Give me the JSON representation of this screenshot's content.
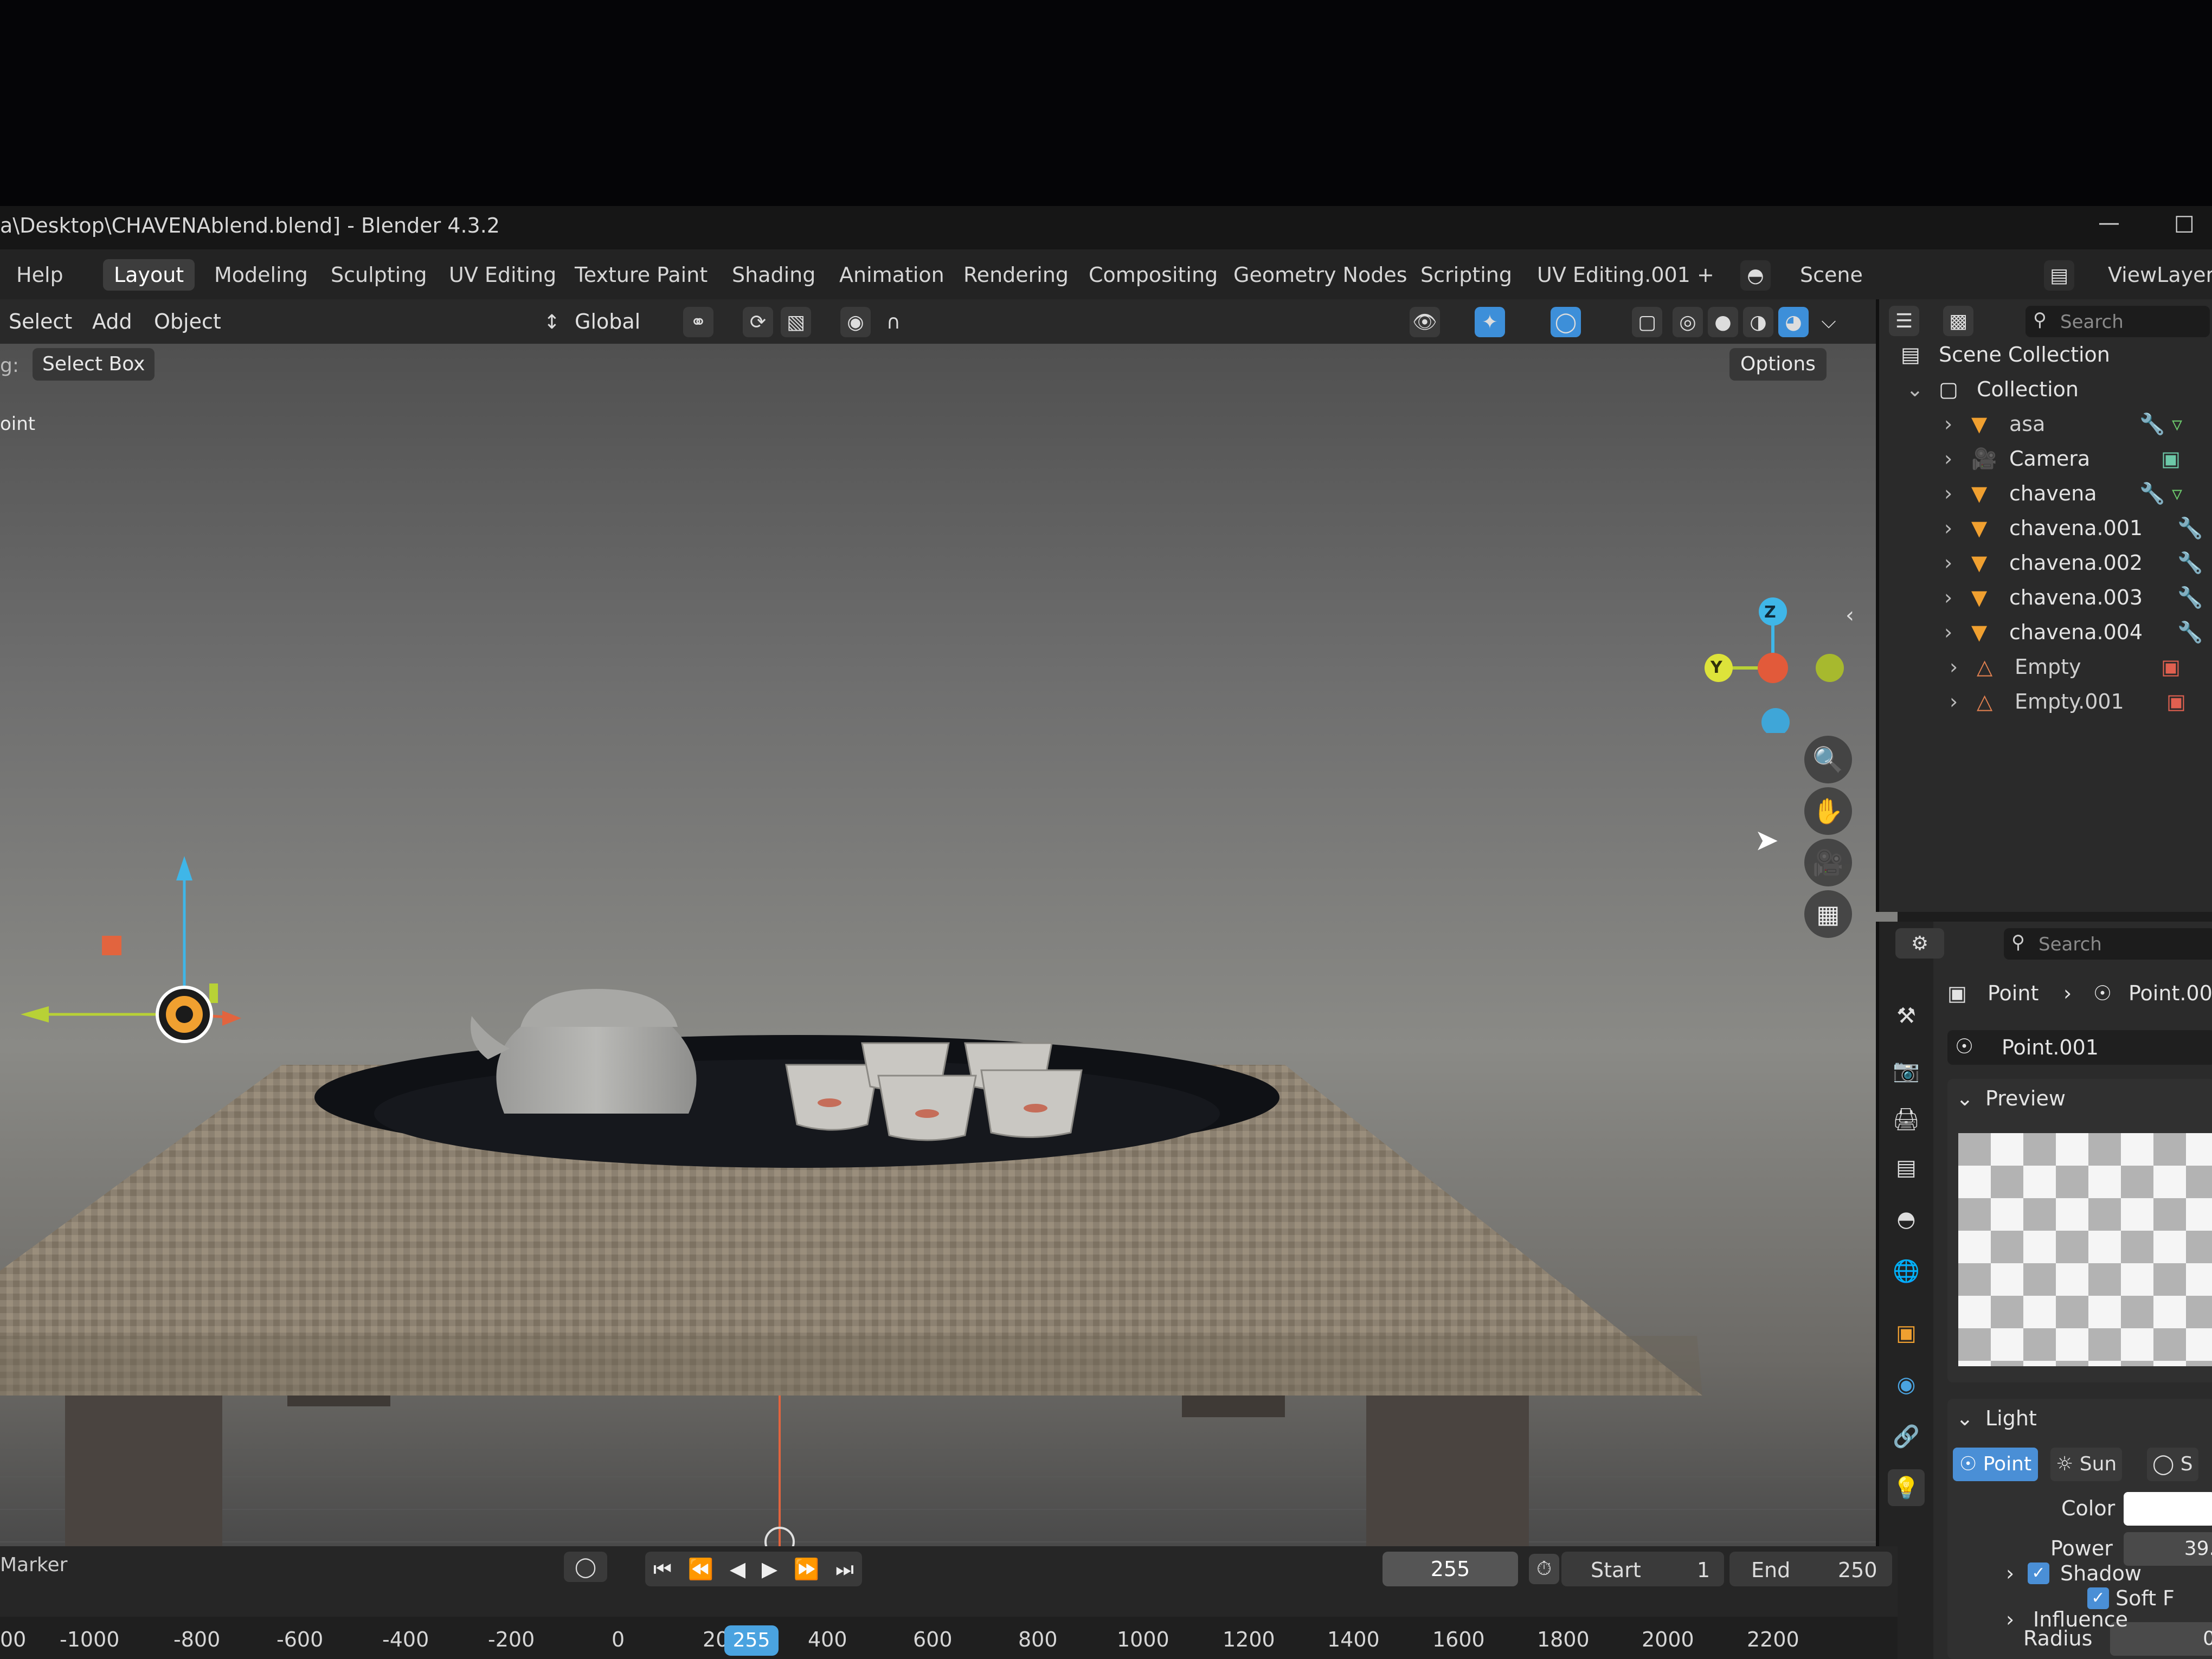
{
  "window": {
    "title": "a\\Desktop\\CHAVENAblend.blend] - Blender 4.3.2",
    "minimize": "—",
    "maximize": "□"
  },
  "menubar": {
    "help": "Help",
    "tabs": [
      "Layout",
      "Modeling",
      "Sculpting",
      "UV Editing",
      "Texture Paint",
      "Shading",
      "Animation",
      "Rendering",
      "Compositing",
      "Geometry Nodes",
      "Scripting",
      "UV Editing.001"
    ],
    "add_tab": "+",
    "scene": "Scene",
    "view_layer": "ViewLayer"
  },
  "viewport": {
    "menu": [
      "Select",
      "Add",
      "Object"
    ],
    "transform": "Global",
    "tool_label": "g:",
    "tool": "Select Box",
    "options": "Options",
    "mode_label": "oint",
    "gizmo": {
      "z": "Z",
      "y": "Y"
    }
  },
  "outliner": {
    "search_placeholder": "Search",
    "scene_collection": "Scene Collection",
    "collection": "Collection",
    "items": [
      "asa",
      "Camera",
      "chavena",
      "chavena.001",
      "chavena.002",
      "chavena.003",
      "chavena.004",
      "Empty",
      "Empty.001"
    ]
  },
  "properties": {
    "search_placeholder": "Search",
    "breadcrumb_object": "Point",
    "breadcrumb_data": "Point.001",
    "datablock": "Point.001",
    "preview_label": "Preview",
    "light_label": "Light",
    "light_types": [
      "Point",
      "Sun",
      "S"
    ],
    "color_label": "Color",
    "power_label": "Power",
    "power_value": "39.",
    "soft_falloff": "Soft F",
    "radius_label": "Radius",
    "radius_value": "0",
    "shadow": "Shadow",
    "influence": "Influence"
  },
  "timeline": {
    "marker": "Marker",
    "current_frame": "255",
    "start_label": "Start",
    "start_value": "1",
    "end_label": "End",
    "end_value": "250",
    "playhead": "255",
    "ruler": [
      "00",
      "-1000",
      "-800",
      "-600",
      "-400",
      "-200",
      "0",
      "20",
      "400",
      "600",
      "800",
      "1000",
      "1200",
      "1400",
      "1600",
      "1800",
      "2000",
      "2200"
    ]
  },
  "colors": {
    "accent": "#4aa3e0",
    "active_blue": "#3d8fd9",
    "axis_x": "#e25a3a",
    "axis_y": "#b8d136",
    "axis_z": "#3fb6e8"
  }
}
